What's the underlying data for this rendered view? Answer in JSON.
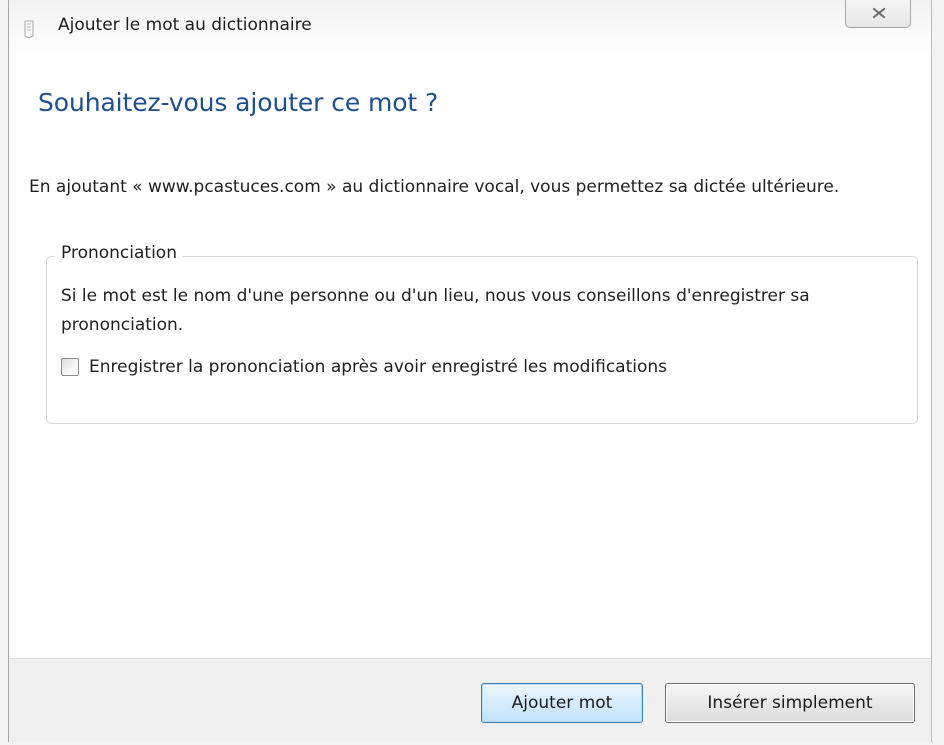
{
  "window": {
    "title": "Ajouter le mot au dictionnaire"
  },
  "content": {
    "heading": "Souhaitez-vous ajouter ce mot ?",
    "description": "En ajoutant « www.pcastuces.com » au dictionnaire vocal, vous permettez sa dictée ultérieure.",
    "group": {
      "label": "Prononciation",
      "text": "Si le mot est le nom d'une personne ou d'un lieu, nous vous conseillons d'enregistrer sa prononciation.",
      "checkbox": {
        "label": "Enregistrer la prononciation après avoir enregistré les modifications",
        "checked": false
      }
    }
  },
  "buttons": {
    "add": "Ajouter mot",
    "insert": "Insérer simplement"
  },
  "icons": {
    "title": "application-icon",
    "close": "close-icon"
  },
  "colors": {
    "heading": "#1d4f91",
    "primary_border": "#3c7fb1",
    "footer_bg": "#f0f0f0"
  }
}
